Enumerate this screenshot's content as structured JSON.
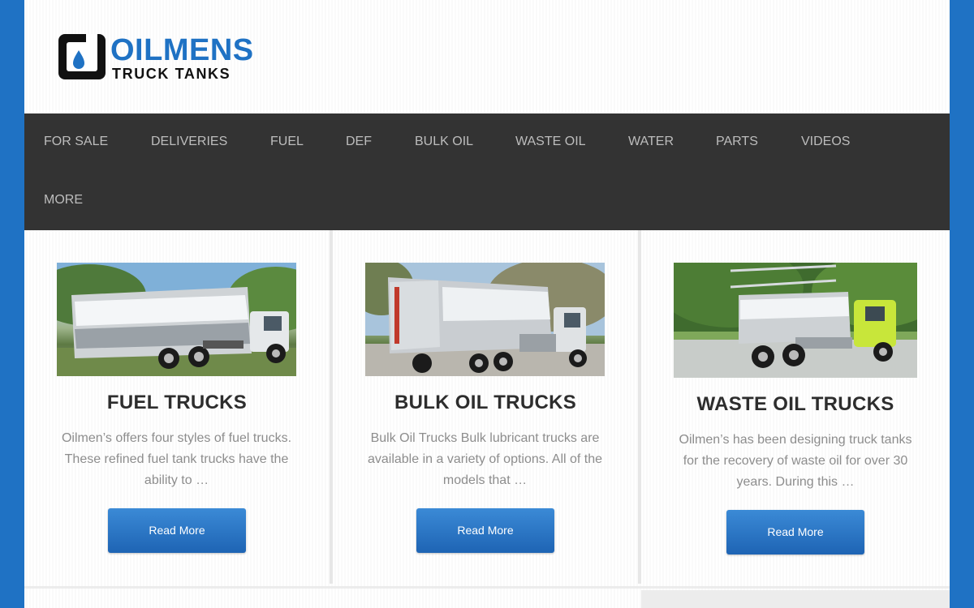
{
  "brand": {
    "name": "OILMENS",
    "tagline": "TRUCK TANKS",
    "accent_color": "#1f72c4",
    "icon": "oil-drop-logo-icon"
  },
  "nav": {
    "items": [
      {
        "label": "FOR SALE"
      },
      {
        "label": "DELIVERIES"
      },
      {
        "label": "FUEL"
      },
      {
        "label": "DEF"
      },
      {
        "label": "BULK OIL"
      },
      {
        "label": "WASTE OIL"
      },
      {
        "label": "WATER"
      },
      {
        "label": "PARTS"
      },
      {
        "label": "VIDEOS"
      },
      {
        "label": "MORE"
      }
    ]
  },
  "cards": [
    {
      "title": "FUEL TRUCKS",
      "excerpt": "Oilmen’s offers four styles of fuel trucks. These refined fuel tank trucks have the ability to …",
      "button": "Read More",
      "image": "polished-fuel-tank-truck-photo"
    },
    {
      "title": "BULK OIL TRUCKS",
      "excerpt": "Bulk Oil Trucks Bulk lubricant trucks are available in a variety of options. All of the models that …",
      "button": "Read More",
      "image": "bulk-oil-tank-truck-photo"
    },
    {
      "title": "WASTE OIL TRUCKS",
      "excerpt": "Oilmen’s has been designing truck tanks for the recovery of waste oil for over 30 years. During this …",
      "button": "Read More",
      "image": "waste-oil-tank-truck-photo"
    }
  ]
}
